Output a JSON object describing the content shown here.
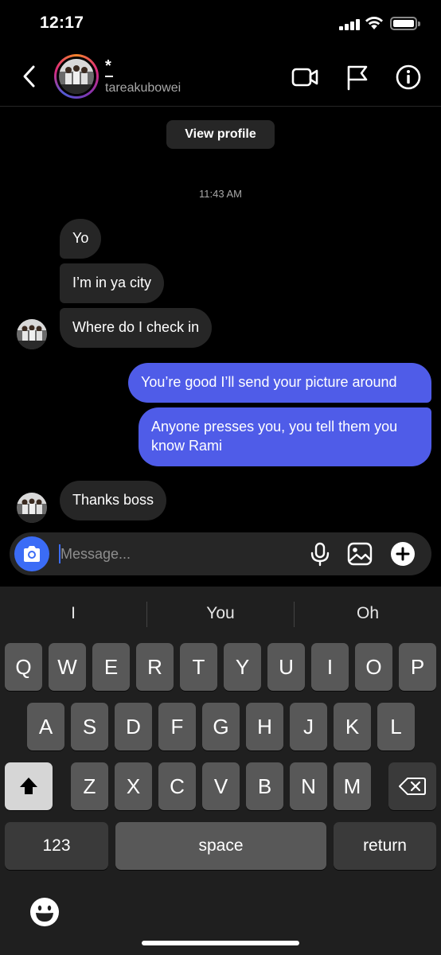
{
  "status_bar": {
    "time": "12:17",
    "icons": [
      "signal-icon",
      "wifi-icon",
      "battery-icon"
    ]
  },
  "header": {
    "back_icon": "chevron-left-icon",
    "name": "*",
    "username": "tareakubowei",
    "icons": [
      "video-call-icon",
      "flag-icon",
      "info-icon"
    ]
  },
  "chat": {
    "view_profile_label": "View profile",
    "timestamp": "11:43 AM",
    "messages": [
      {
        "from": "them",
        "text": "Yo"
      },
      {
        "from": "them",
        "text": "I’m in ya city"
      },
      {
        "from": "them",
        "text": "Where do I check in"
      },
      {
        "from": "me",
        "text": "You’re good I’ll send your picture around"
      },
      {
        "from": "me",
        "text": "Anyone presses you, you tell them you know Rami"
      },
      {
        "from": "them",
        "text": "Thanks boss"
      }
    ]
  },
  "composer": {
    "placeholder": "Message...",
    "icons": [
      "camera-icon",
      "microphone-icon",
      "gallery-icon",
      "plus-icon"
    ]
  },
  "keyboard": {
    "suggestions": [
      "I",
      "You",
      "Oh"
    ],
    "row1": [
      "Q",
      "W",
      "E",
      "R",
      "T",
      "Y",
      "U",
      "I",
      "O",
      "P"
    ],
    "row2": [
      "A",
      "S",
      "D",
      "F",
      "G",
      "H",
      "J",
      "K",
      "L"
    ],
    "row3": [
      "Z",
      "X",
      "C",
      "V",
      "B",
      "N",
      "M"
    ],
    "numbers_label": "123",
    "space_label": "space",
    "return_label": "return",
    "icons": [
      "shift-icon",
      "backspace-icon",
      "emoji-icon"
    ]
  },
  "colors": {
    "outgoing_bubble": "#4f5ce8",
    "incoming_bubble": "#262626",
    "accent_blue": "#3b6cf6",
    "background": "#000000"
  }
}
